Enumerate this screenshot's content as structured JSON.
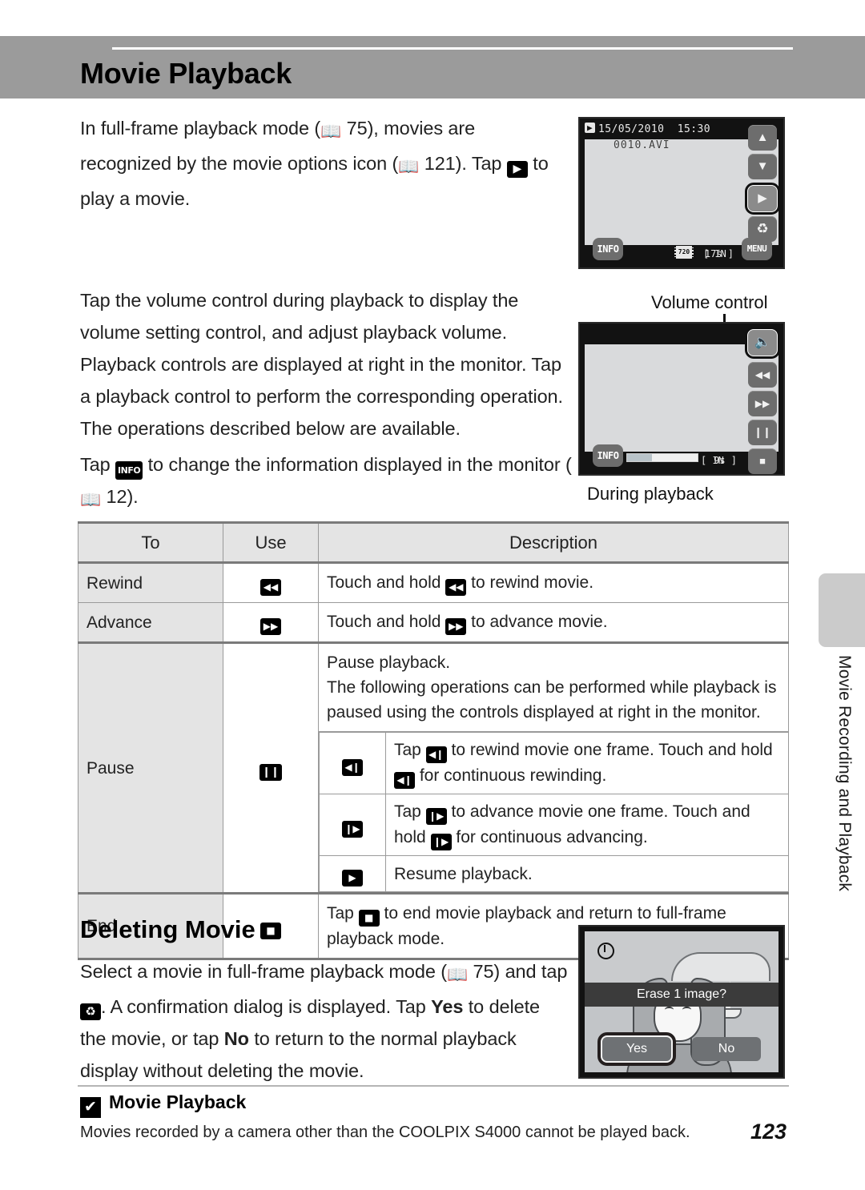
{
  "header": {
    "title": "Movie Playback"
  },
  "paragraphs": {
    "p1_a": "In full-frame playback mode (",
    "p1_page": "75",
    "p1_b": "), movies are recognized by the movie options icon (",
    "p1_page2": "121",
    "p1_c": "). Tap ",
    "p1_play_icon": "▶",
    "p1_d": " to play a movie.",
    "p2": "Tap the volume control during playback to display the volume setting control, and adjust playback volume.",
    "p3": "Playback controls are displayed at right in the monitor. Tap a playback control to perform the corresponding operation. The operations described below are available.",
    "p4_a": "Tap ",
    "p4_info_icon": "INFO",
    "p4_b": " to change the information displayed in the monitor (",
    "p4_page": "12",
    "p4_c": ")."
  },
  "screen_fullframe": {
    "mode_icon": "▶",
    "date": "15/05/2010",
    "time": "15:30",
    "filename": "0010.AVI",
    "info_label": "INFO",
    "menu_label": "MENU",
    "quality_label": "720",
    "memory_label": "[ IN",
    "duration_label": "17s ]",
    "buttons": {
      "up": "▲",
      "down": "▼",
      "play": "▶",
      "delete": "Ὕ1"
    }
  },
  "screen_playback": {
    "callout": "Volume control",
    "caption": "During playback",
    "info_label": "INFO",
    "memory_label": "[ IN",
    "duration_label": "9s ]",
    "progress_percent": 35,
    "buttons": {
      "volume": "🔊",
      "rewind": "◀◀",
      "advance": "▶▶",
      "pause": "❙❙",
      "stop": "■"
    }
  },
  "screen_erase": {
    "message": "Erase 1 image?",
    "yes_label": "Yes",
    "no_label": "No"
  },
  "table": {
    "headers": [
      "To",
      "Use",
      "Description"
    ],
    "rows": [
      {
        "to": "Rewind",
        "use_icon": "◀◀",
        "desc_a": "Touch and hold ",
        "desc_icon": "◀◀",
        "desc_b": " to rewind movie."
      },
      {
        "to": "Advance",
        "use_icon": "▶▶",
        "desc_a": "Touch and hold ",
        "desc_icon": "▶▶",
        "desc_b": " to advance movie."
      }
    ],
    "pause_row": {
      "to": "Pause",
      "use_icon": "❙❙",
      "intro_line1": "Pause playback.",
      "intro_line2": "The following operations can be performed while playback is paused using the controls displayed at right in the monitor.",
      "sub_rows": [
        {
          "use_icon": "◀❙",
          "text_a": "Tap ",
          "icon1": "◀❙",
          "text_b": " to rewind movie one frame. Touch and hold ",
          "icon2": "◀❙",
          "text_c": " for continuous rewinding."
        },
        {
          "use_icon": "❙▶",
          "text_a": "Tap ",
          "icon1": "❙▶",
          "text_b": " to advance movie one frame. Touch and hold ",
          "icon2": "❙▶",
          "text_c": " for continuous advancing."
        },
        {
          "use_icon": "▶",
          "text_a": "Resume playback.",
          "icon1": "",
          "text_b": "",
          "icon2": "",
          "text_c": ""
        }
      ]
    },
    "end_row": {
      "to": "End",
      "use_icon": "■",
      "desc_a": "Tap ",
      "desc_icon": "■",
      "desc_b": " to end movie playback and return to full-frame playback mode."
    }
  },
  "deleting": {
    "heading": "Deleting Movie",
    "text_a": "Select a movie in full-frame playback mode (",
    "page": "75",
    "text_b": ") and tap ",
    "trash_icon": "Ὕ1",
    "text_c": ". A confirmation dialog is displayed. Tap ",
    "yes": "Yes",
    "text_d": " to delete the movie, or tap ",
    "no": "No",
    "text_e": " to return to the normal playback display without deleting the movie."
  },
  "note": {
    "mark": "✔",
    "title": "Movie Playback",
    "body": "Movies recorded by a camera other than the COOLPIX S4000 cannot be played back."
  },
  "side_tab": {
    "label": "Movie Recording and Playback"
  },
  "page_number": "123"
}
